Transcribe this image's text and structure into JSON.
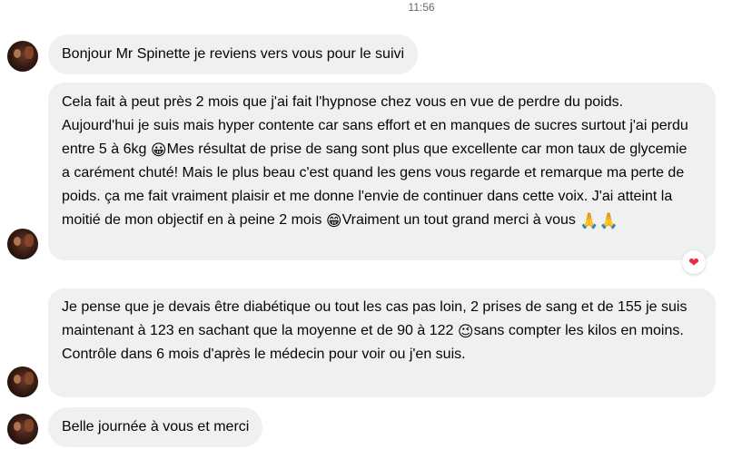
{
  "timestamp": "11:56",
  "messages": [
    {
      "text": "Bonjour Mr Spinette je reviens vers vous pour le suivi"
    },
    {
      "part1": "Cela fait à peut près 2 mois que j'ai fait l'hypnose chez vous en vue de perdre du poids. Aujourd'hui je suis mais hyper contente car sans  effort et en manques de sucres surtout j'ai perdu entre 5 à 6kg ",
      "emoji1": "😀",
      "part2": "Mes résultat de prise de sang sont plus que excellente car mon taux de glycemie a carément  chuté! Mais le plus beau c'est quand les gens vous regarde et remarque ma perte de poids. ça me fait vraiment plaisir et me donne l'envie de continuer dans cette voix. J'ai atteint la moitié de mon objectif en à peine 2 mois ",
      "emoji2": "😁",
      "part3": "Vraiment un tout grand merci à vous ",
      "emoji3": "🙏🙏",
      "reaction": "❤"
    },
    {
      "part1": "Je pense que je devais être diabétique ou tout les cas pas loin, 2 prises de sang et de 155 je suis maintenant à 123 en sachant que la moyenne et de 90 à 122 ",
      "emoji1": "😉",
      "part2": "sans compter les kilos en moins. Contrôle dans 6 mois d'après le médecin pour voir ou j'en suis."
    },
    {
      "text": "Belle journée à vous et merci"
    }
  ]
}
